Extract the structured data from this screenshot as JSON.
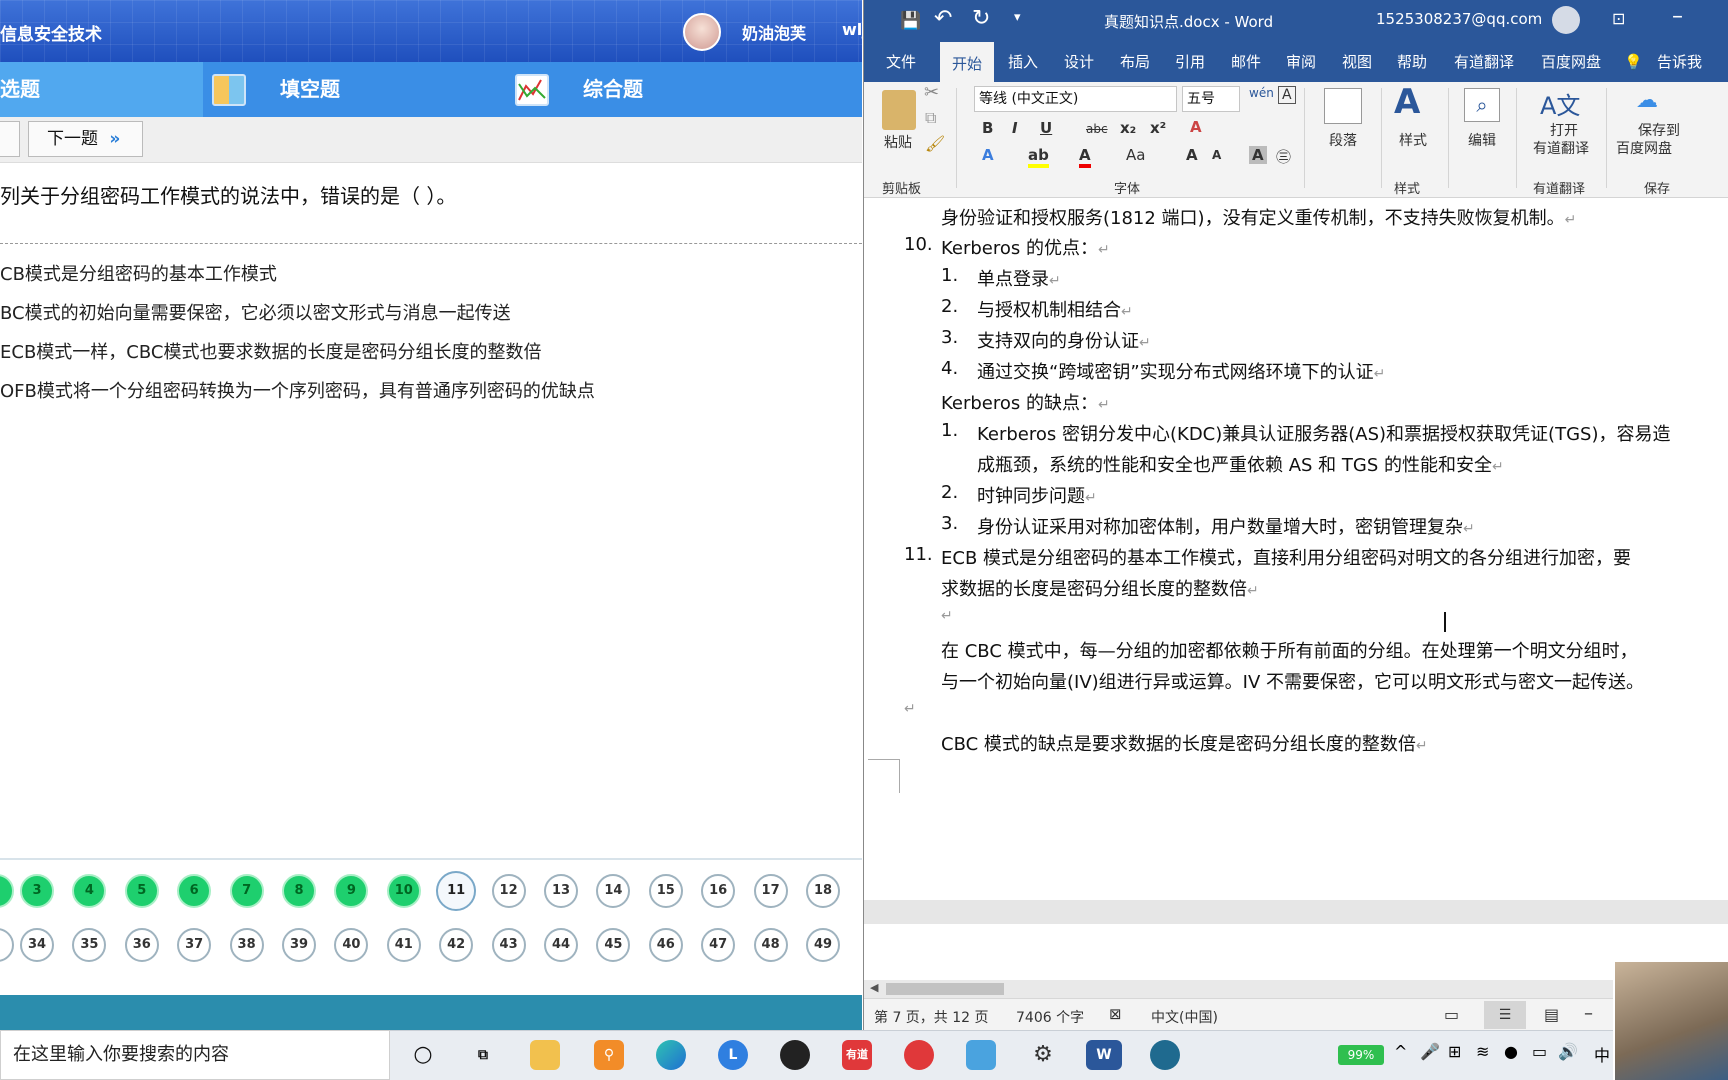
{
  "quiz": {
    "app_title": "信息安全技术",
    "user_name": "奶油泡芙",
    "user_extra": "wlj",
    "tabs": [
      "选题",
      "填空题",
      "综合题"
    ],
    "next_button": "下一题",
    "question": "列关于分组密码工作模式的说法中，错误的是（ ）。",
    "options": [
      "CB模式是分组密码的基本工作模式",
      "BC模式的初始向量需要保密，它必须以密文形式与消息一起传送",
      "ECB模式一样，CBC模式也要求数据的长度是密码分组长度的整数倍",
      "OFB模式将一个分组密码转换为一个序列密码，具有普通序列密码的优缺点"
    ],
    "numbers_row1": [
      "3",
      "4",
      "5",
      "6",
      "7",
      "8",
      "9",
      "10",
      "11",
      "12",
      "13",
      "14",
      "15",
      "16",
      "17",
      "18"
    ],
    "numbers_row1_done_count": 8,
    "current_number": "11",
    "numbers_row2": [
      "34",
      "35",
      "36",
      "37",
      "38",
      "39",
      "40",
      "41",
      "42",
      "43",
      "44",
      "45",
      "46",
      "47",
      "48",
      "49"
    ]
  },
  "word": {
    "doc_title": "真题知识点.docx  -  Word",
    "account": "1525308237@qq.com",
    "menu": [
      "文件",
      "开始",
      "插入",
      "设计",
      "布局",
      "引用",
      "邮件",
      "审阅",
      "视图",
      "帮助",
      "有道翻译",
      "百度网盘",
      "告诉我"
    ],
    "active_menu": "开始",
    "ribbon": {
      "paste": "粘贴",
      "clipboard": "剪贴板",
      "font_name": "等线 (中文正文)",
      "font_size": "五号",
      "font_group": "字体",
      "paragraph": "段落",
      "styles": "样式",
      "styles_group": "样式",
      "edit": "编辑",
      "open_youdao_1": "打开",
      "open_youdao_2": "有道翻译",
      "youdao_group": "有道翻译",
      "save_baidu_1": "保存到",
      "save_baidu_2": "百度网盘",
      "save_group": "保存"
    },
    "doc": {
      "l1": "身份验证和授权服务(1812 端口)，没有定义重传机制，不支持失败恢复机制。",
      "n10": "10.",
      "l2": "Kerberos 的优点：",
      "a1": "单点登录",
      "a2": "与授权机制相结合",
      "a3": "支持双向的身份认证",
      "a4": "通过交换“跨域密钥”实现分布式网络环境下的认证",
      "l3": "Kerberos 的缺点：",
      "b1a": "Kerberos 密钥分发中心(KDC)兼具认证服务器(AS)和票据授权获取凭证(TGS)，容易造",
      "b1b": "成瓶颈，系统的性能和安全也严重依赖 AS 和 TGS 的性能和安全",
      "b2": "时钟同步问题",
      "b3": "身份认证采用对称加密体制，用户数量增大时，密钥管理复杂",
      "n11": "11.",
      "c1a": "ECB 模式是分组密码的基本工作模式，直接利用分组密码对明文的各分组进行加密，要",
      "c1b": "求数据的长度是密码分组长度的整数倍",
      "c2a": "在 CBC 模式中，每—分组的加密都依赖于所有前面的分组。在处理第一个明文分组时，",
      "c2b": "与一个初始向量(IV)组进行异或运算。IV 不需要保密，它可以明文形式与密文一起传送。",
      "c3": "CBC 模式的缺点是要求数据的长度是密码分组长度的整数倍",
      "list_nums": [
        "1.",
        "2.",
        "3.",
        "4."
      ]
    },
    "status": {
      "page": "第 7 页，共 12 页",
      "words": "7406 个字",
      "lang": "中文(中国)"
    }
  },
  "taskbar": {
    "search_placeholder": "在这里输入你要搜索的内容",
    "battery": "99%",
    "ime": "中",
    "youdao_label": "有道"
  }
}
